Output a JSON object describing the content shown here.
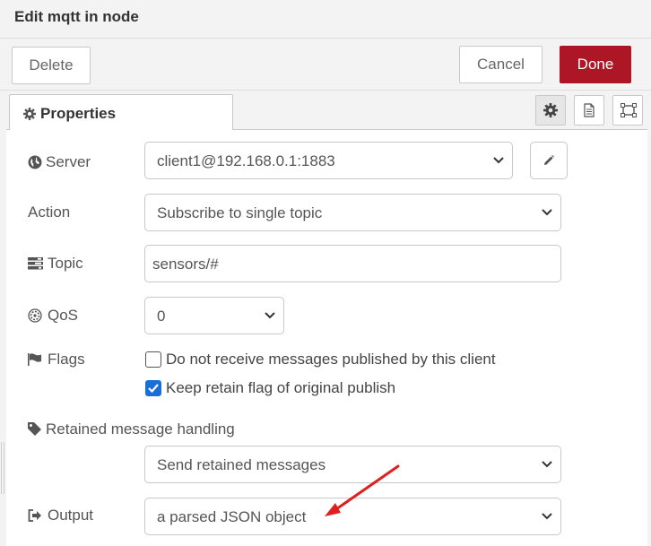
{
  "tray": {
    "title": "Edit mqtt in node",
    "delete_label": "Delete",
    "cancel_label": "Cancel",
    "done_label": "Done"
  },
  "tabs": {
    "properties_label": "Properties",
    "icons": [
      "gear-icon",
      "document-icon",
      "frame-icon"
    ]
  },
  "form": {
    "server": {
      "label": "Server",
      "value": "client1@192.168.0.1:1883",
      "icon": "globe-icon"
    },
    "action": {
      "label": "Action",
      "value": "Subscribe to single topic"
    },
    "topic": {
      "label": "Topic",
      "value": "sensors/#",
      "icon": "tasks-icon"
    },
    "qos": {
      "label": "QoS",
      "value": "0",
      "icon": "empire-icon"
    },
    "flags": {
      "label": "Flags",
      "icon": "flag-icon",
      "options": [
        {
          "label": "Do not receive messages published by this client",
          "checked": false
        },
        {
          "label": "Keep retain flag of original publish",
          "checked": true
        }
      ]
    },
    "retained": {
      "label": "Retained message handling",
      "value": "Send retained messages",
      "icon": "tag-icon"
    },
    "output": {
      "label": "Output",
      "value": "a parsed JSON object",
      "icon": "sign-out-icon"
    }
  },
  "colors": {
    "done": "#ad1625",
    "checkbox": "#1a6ed8",
    "annotation_arrow": "#e02020"
  }
}
